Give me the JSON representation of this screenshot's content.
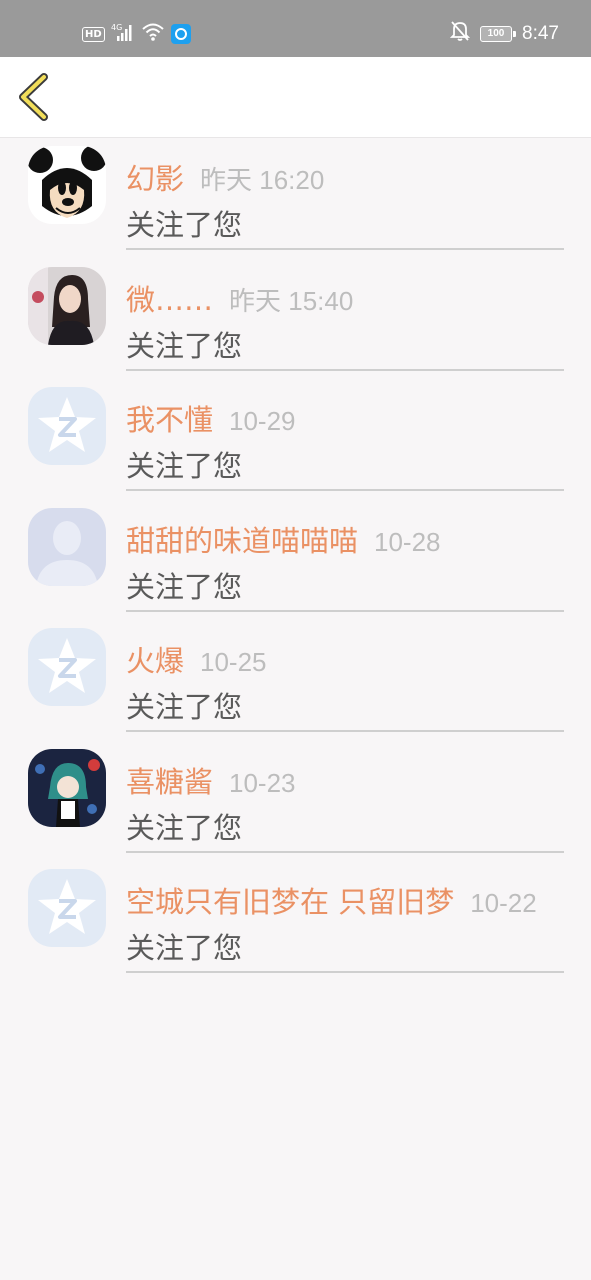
{
  "status_bar": {
    "left_badge": "HD",
    "signal_label": "4G",
    "battery": "100",
    "time": "8:47"
  },
  "header": {
    "back_icon": "chevron-left-icon"
  },
  "notifications": [
    {
      "name": "幻影",
      "time": "昨天 16:20",
      "action": "关注了您",
      "avatar": "mickey"
    },
    {
      "name": "微……",
      "time": "昨天 15:40",
      "action": "关注了您",
      "avatar": "photo-girl"
    },
    {
      "name": "我不懂",
      "time": "10-29",
      "action": "关注了您",
      "avatar": "qq-default"
    },
    {
      "name": "甜甜的味道喵喵喵",
      "time": "10-28",
      "action": "关注了您",
      "avatar": "silhouette"
    },
    {
      "name": "火爆",
      "time": "10-25",
      "action": "关注了您",
      "avatar": "qq-default"
    },
    {
      "name": "喜糖酱",
      "time": "10-23",
      "action": "关注了您",
      "avatar": "anime"
    },
    {
      "name": "空城只有旧梦在 只留旧梦",
      "time": "10-22",
      "action": "关注了您",
      "avatar": "qq-default"
    }
  ],
  "colors": {
    "name": "#ea9164",
    "time": "#bdbdbd",
    "action": "#5a5a5a",
    "background": "#f8f6f7",
    "status_bar": "#9a9a9a"
  }
}
